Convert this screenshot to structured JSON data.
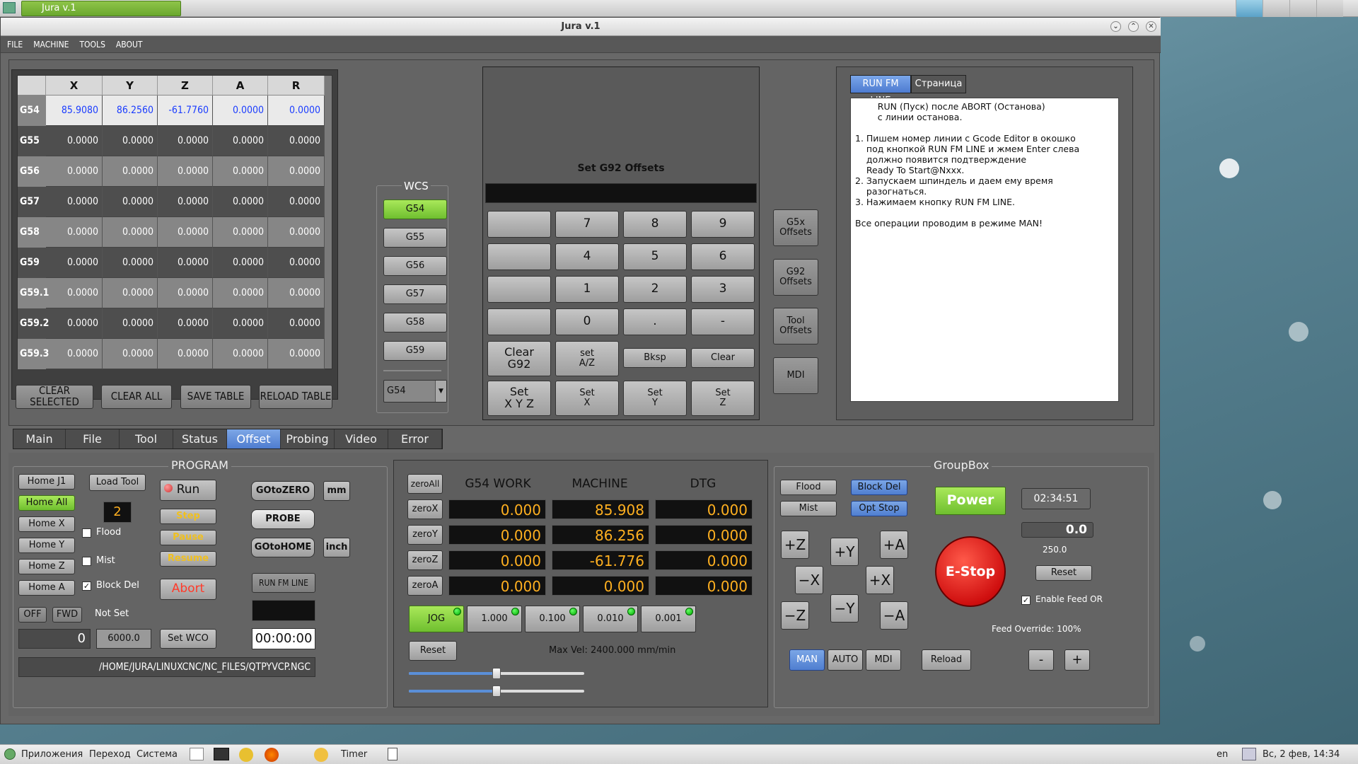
{
  "top_panel": {
    "task_title": "Jura v.1"
  },
  "window": {
    "title": "Jura v.1",
    "btn_min": "⌄",
    "btn_max": "⌃",
    "btn_close": "✕"
  },
  "menu": [
    "FILE",
    "MACHINE",
    "TOOLS",
    "ABOUT"
  ],
  "offset_table": {
    "columns": [
      "X",
      "Y",
      "Z",
      "A",
      "R"
    ],
    "rows": [
      {
        "name": "G54",
        "values": [
          "85.9080",
          "86.2560",
          "-61.7760",
          "0.0000",
          "0.0000"
        ]
      },
      {
        "name": "G55",
        "values": [
          "0.0000",
          "0.0000",
          "0.0000",
          "0.0000",
          "0.0000"
        ]
      },
      {
        "name": "G56",
        "values": [
          "0.0000",
          "0.0000",
          "0.0000",
          "0.0000",
          "0.0000"
        ]
      },
      {
        "name": "G57",
        "values": [
          "0.0000",
          "0.0000",
          "0.0000",
          "0.0000",
          "0.0000"
        ]
      },
      {
        "name": "G58",
        "values": [
          "0.0000",
          "0.0000",
          "0.0000",
          "0.0000",
          "0.0000"
        ]
      },
      {
        "name": "G59",
        "values": [
          "0.0000",
          "0.0000",
          "0.0000",
          "0.0000",
          "0.0000"
        ]
      },
      {
        "name": "G59.1",
        "values": [
          "0.0000",
          "0.0000",
          "0.0000",
          "0.0000",
          "0.0000"
        ]
      },
      {
        "name": "G59.2",
        "values": [
          "0.0000",
          "0.0000",
          "0.0000",
          "0.0000",
          "0.0000"
        ]
      },
      {
        "name": "G59.3",
        "values": [
          "0.0000",
          "0.0000",
          "0.0000",
          "0.0000",
          "0.0000"
        ]
      }
    ],
    "buttons": {
      "clear_selected": "CLEAR SELECTED",
      "clear_all": "CLEAR ALL",
      "save": "SAVE TABLE",
      "reload": "RELOAD TABLE"
    }
  },
  "wcs": {
    "title": "WCS",
    "buttons": [
      "G54",
      "G55",
      "G56",
      "G57",
      "G58",
      "G59"
    ],
    "selected": "G54",
    "dropdown": "G54"
  },
  "g92": {
    "title": "Set G92 Offsets",
    "keys": {
      "k7": "7",
      "k8": "8",
      "k9": "9",
      "k4": "4",
      "k5": "5",
      "k6": "6",
      "k1": "1",
      "k2": "2",
      "k3": "3",
      "k0": "0",
      "dot": ".",
      "minus": "-"
    },
    "clear_g92": "Clear\nG92",
    "set_az": "set\nA/Z",
    "bksp": "Bksp",
    "clear": "Clear",
    "set_xyz": "Set\nX Y Z",
    "set_x": "Set\nX",
    "set_y": "Set\nY",
    "set_z": "Set\nZ"
  },
  "side_buttons": {
    "g5x": "G5x\nOffsets",
    "g92": "G92\nOffsets",
    "tool": "Tool\nOffsets",
    "mdi": "MDI"
  },
  "help": {
    "tabs": [
      "RUN FM LINE",
      "Страница"
    ],
    "text": "        RUN (Пуск) после ABORT (Останова)\n        с линии останова.\n\n1. Пишем номер линии с Gcode Editor в окошко\n    под кнопкой RUN FM LINE и жмем Enter слева\n    должно появится подтверждение\n    Ready To Start@Nxxx.\n2. Запускаем шпиндель и даем ему время\n    разогнаться.\n3. Нажимаем кнопку RUN FM LINE.\n\nВсе операции проводим в режиме MAN!"
  },
  "main_tabs": [
    "Main",
    "File",
    "Tool",
    "Status",
    "Offset",
    "Probing",
    "Video",
    "Error"
  ],
  "active_tab": "Offset",
  "program": {
    "title": "PROGRAM",
    "home_j1": "Home J1",
    "home_all": "Home All",
    "home_x": "Home X",
    "home_y": "Home Y",
    "home_z": "Home Z",
    "home_a": "Home A",
    "load_tool": "Load Tool",
    "tool_number": "2",
    "flood": "Flood",
    "mist": "Mist",
    "block_del": "Block Del",
    "run": "Run",
    "step": "Step",
    "pause": "Pause",
    "resume": "Resume",
    "abort": "Abort",
    "goto_zero": "GOtoZERO",
    "probe": "PROBE",
    "goto_home": "GOtoHOME",
    "mm": "mm",
    "inch": "inch",
    "run_fm_line": "RUN FM LINE",
    "off": "OFF",
    "fwd": "FWD",
    "spindle_status": "Not Set",
    "spindle_value": "0",
    "spindle_rpm": "6000.0",
    "set_wco": "Set WCO",
    "timer": "00:00:00",
    "file_path": "/HOME/JURA/LINUXCNC/NC_FILES/QTPYVCP.NGC"
  },
  "dro": {
    "headers": {
      "work": "G54 WORK",
      "machine": "MACHINE",
      "dtg": "DTG"
    },
    "zero_all": "zeroAll",
    "axes": [
      {
        "btn": "zeroX",
        "work": "0.000",
        "machine": "85.908",
        "dtg": "0.000"
      },
      {
        "btn": "zeroY",
        "work": "0.000",
        "machine": "86.256",
        "dtg": "0.000"
      },
      {
        "btn": "zeroZ",
        "work": "0.000",
        "machine": "-61.776",
        "dtg": "0.000"
      },
      {
        "btn": "zeroA",
        "work": "0.000",
        "machine": "0.000",
        "dtg": "0.000"
      }
    ],
    "jog": "JOG",
    "inc1": "1.000",
    "inc2": "0.100",
    "inc3": "0.010",
    "inc4": "0.001",
    "reset": "Reset",
    "max_vel": "Max Vel: 2400.000 mm/min",
    "slider1_fraction": 0.5,
    "slider2_fraction": 0.5
  },
  "groupbox": {
    "title": "GroupBox",
    "flood": "Flood",
    "mist": "Mist",
    "block_del": "Block Del",
    "opt_stop": "Opt Stop",
    "power": "Power",
    "clock": "02:34:51",
    "feed_value": "0.0",
    "feed_max": "250.0",
    "reset": "Reset",
    "estop": "E-Stop",
    "enable_feed_or": "Enable Feed OR",
    "feed_override": "Feed Override: 100%",
    "jog_zp": "+Z",
    "jog_yp": "+Y",
    "jog_ap": "+A",
    "jog_xm": "−X",
    "jog_xp": "+X",
    "jog_zm": "−Z",
    "jog_ym": "−Y",
    "jog_am": "−A",
    "man": "MAN",
    "auto": "AUTO",
    "mdi": "MDI",
    "reload": "Reload",
    "minus": "-",
    "plus": "+"
  },
  "taskbar": {
    "apps": "Приложения",
    "places": "Переход",
    "system": "Система",
    "timer": "Timer",
    "lang": "en",
    "clock": "Вс, 2 фев, 14:34"
  }
}
